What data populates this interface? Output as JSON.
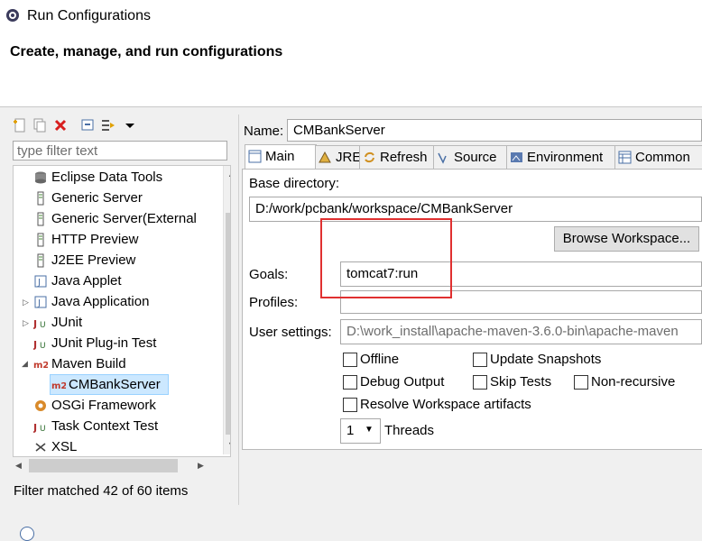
{
  "window": {
    "title": "Run Configurations"
  },
  "header": {
    "heading": "Create, manage, and run configurations"
  },
  "toolbar": {
    "icons": [
      "new-configuration-icon",
      "duplicate-icon",
      "delete-icon",
      "collapse-all-icon",
      "filter-icon",
      "dropdown-icon"
    ]
  },
  "filter": {
    "placeholder": "type filter text"
  },
  "tree": {
    "items": [
      {
        "label": "Eclipse Data Tools",
        "icon": "data-tools-icon"
      },
      {
        "label": "Generic Server",
        "icon": "server-icon"
      },
      {
        "label": "Generic Server(External",
        "icon": "server-icon"
      },
      {
        "label": "HTTP Preview",
        "icon": "server-icon"
      },
      {
        "label": "J2EE Preview",
        "icon": "server-icon"
      },
      {
        "label": "Java Applet",
        "icon": "java-applet-icon"
      },
      {
        "label": "Java Application",
        "icon": "java-application-icon"
      },
      {
        "label": "JUnit",
        "icon": "junit-icon"
      },
      {
        "label": "JUnit Plug-in Test",
        "icon": "junit-plugin-icon"
      },
      {
        "label": "Maven Build",
        "icon": "maven-icon"
      },
      {
        "label": "CMBankServer",
        "icon": "maven-icon"
      },
      {
        "label": "OSGi Framework",
        "icon": "osgi-icon"
      },
      {
        "label": "Task Context Test",
        "icon": "task-icon"
      },
      {
        "label": "XSL",
        "icon": "xsl-icon"
      }
    ]
  },
  "status": {
    "filter_text": "Filter matched 42 of 60 items"
  },
  "config": {
    "name_label": "Name:",
    "name_value": "CMBankServer",
    "tabs": [
      {
        "label": "Main",
        "icon": "main-tab-icon"
      },
      {
        "label": "JRE",
        "icon": "jre-icon"
      },
      {
        "label": "Refresh",
        "icon": "refresh-icon"
      },
      {
        "label": "Source",
        "icon": "source-icon"
      },
      {
        "label": "Environment",
        "icon": "environment-icon"
      },
      {
        "label": "Common",
        "icon": "common-icon"
      }
    ],
    "base_dir_label": "Base directory:",
    "base_dir_value": "D:/work/pcbank/workspace/CMBankServer",
    "browse_workspace": "Browse Workspace...",
    "goals_label": "Goals:",
    "goals_value": "tomcat7:run",
    "profiles_label": "Profiles:",
    "profiles_value": "",
    "user_settings_label": "User settings:",
    "user_settings_value": "D:\\work_install\\apache-maven-3.6.0-bin\\apache-maven",
    "checkboxes": {
      "offline": "Offline",
      "update_snapshots": "Update Snapshots",
      "debug_output": "Debug Output",
      "skip_tests": "Skip Tests",
      "non_recursive": "Non-recursive",
      "resolve_workspace": "Resolve Workspace artifacts"
    },
    "threads_value": "1",
    "threads_label": "Threads"
  },
  "colors": {
    "selection": "#cce8ff",
    "highlight_box": "#e03030",
    "maven_red": "#c0392b"
  }
}
